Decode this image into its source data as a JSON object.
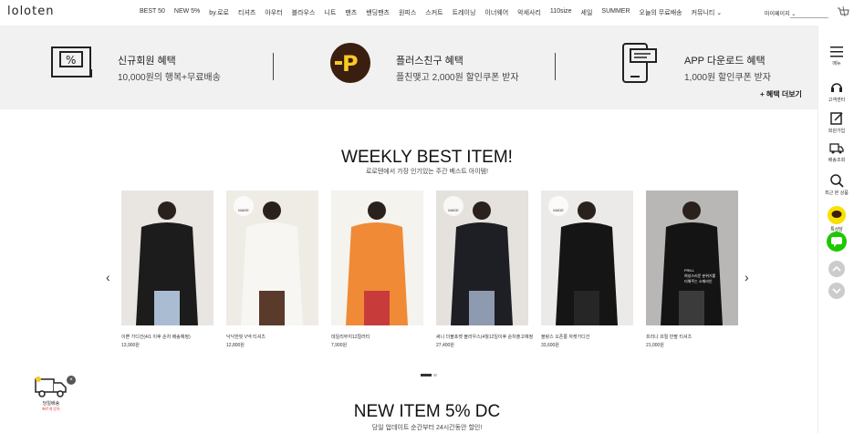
{
  "header": {
    "logo": "loloten",
    "nav": [
      "BEST 50",
      "NEW 5%",
      "by.로로",
      "티셔츠",
      "아우터",
      "블라우스",
      "니트",
      "팬츠",
      "밴딩팬츠",
      "원피스",
      "스커트",
      "트레이닝",
      "이너웨어",
      "악세사리",
      "110size",
      "세일",
      "SUMMER",
      "오늘의 무료배송",
      "커뮤니티 ⌄"
    ],
    "mypage": "마이페이지 ⌄",
    "icons": {
      "cart": "cart-icon"
    }
  },
  "benefits": {
    "items": [
      {
        "title": "신규회원 혜택",
        "desc": "10,000원의 행복+무료배송",
        "icon": "coupon-icon"
      },
      {
        "title": "플러스친구 혜택",
        "desc": "플친맺고 2,000원 할인쿠폰 받자",
        "icon": "plusfriend-icon"
      },
      {
        "title": "APP 다운로드 혜택",
        "desc": "1,000원 할인쿠폰 받자",
        "icon": "app-phone-icon"
      }
    ],
    "more": "+ 혜택 더보기"
  },
  "quick": {
    "menu": "메뉴",
    "cs": "고객센터",
    "join": "회원가입",
    "delivery": "배송조회",
    "recent": "최근 본 상품",
    "kakao": "톡상담"
  },
  "weekly": {
    "title": "WEEKLY BEST ITEM!",
    "subtitle": "로로텐에서 가장 인기있는 주간 베스트 아이템!",
    "products": [
      {
        "name": "이쁜 가디건(4/1 이후 순차 배송예정)",
        "price": "13,900원",
        "price2": "",
        "made": false,
        "colors": [
          "#e9e6e2",
          "#1c1c1c",
          "#a9bcd2"
        ]
      },
      {
        "name": "낙낙한핏 V넥 티셔츠",
        "price": "12,800원",
        "price2": "",
        "made": true,
        "made_label": "MADE",
        "colors": [
          "#efece6",
          "#f7f6f2",
          "#5a3a2a"
        ]
      },
      {
        "name": "데일리무지12컬러티",
        "price": "7,900원",
        "price2": "",
        "made": false,
        "colors": [
          "#f5f3ee",
          "#f08a36",
          "#c73b3b"
        ]
      },
      {
        "name": "써니 더블포켓 블라우스(4월12일이후 순차출고예정)",
        "price": "27,400원",
        "price2": "",
        "made": true,
        "made_label": "MADE",
        "colors": [
          "#e5e2dd",
          "#1e1f24",
          "#8e9ab0"
        ]
      },
      {
        "name": "블랑스 오픈롱 자켓가디건",
        "price": "33,600원",
        "price2": "",
        "made": true,
        "made_label": "MADE",
        "colors": [
          "#eceae8",
          "#151515",
          "#262626"
        ]
      },
      {
        "name": "프리나 프릴 반팔 티셔츠",
        "price": "21,000원",
        "price2": "",
        "made": false,
        "colors": [
          "#b9b7b5",
          "#141414",
          "#3b3b3b"
        ],
        "overlay": "FRILL\n여성스러운 분위기를\n더해주는 소매라인"
      }
    ]
  },
  "newitem": {
    "title": "NEW ITEM 5% DC",
    "subtitle": "당일 업데이트 순간부터 24시간동안 할인!"
  },
  "float_truck": {
    "line1": "당일배송",
    "line2": "빠르게 받자",
    "close": "×"
  }
}
